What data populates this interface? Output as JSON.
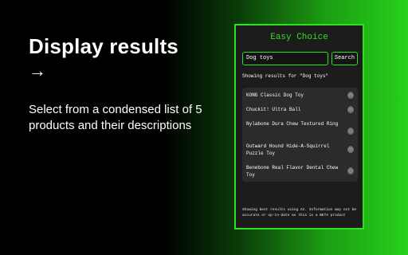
{
  "promo": {
    "title": "Display results",
    "arrow": "→",
    "description": "Select from a condensed list of 5 products and their descriptions"
  },
  "popup": {
    "app_title": "Easy Choice",
    "search_value": "Dog toys",
    "search_button": "Search",
    "results_heading": "Showing results for \"Dog toys\"",
    "results": [
      {
        "name": "KONG Classic Dog Toy",
        "info_icon": "ⓘ"
      },
      {
        "name": "Chuckit! Ultra Ball",
        "info_icon": "ⓘ"
      },
      {
        "name": "Nylabone Dura Chew Textured Ring",
        "info_icon": "ⓘ"
      },
      {
        "name": "Outward Hound Hide-A-Squirrel Puzzle Toy",
        "info_icon": "ⓘ"
      },
      {
        "name": "Benebone Real Flavor Dental Chew Toy",
        "info_icon": "ⓘ"
      }
    ],
    "disclaimer": "Showing best results using AI. Information may not be accurate or up-to-date as this is a BETA product"
  },
  "colors": {
    "accent": "#2ee01f",
    "popup_bg": "#1c1c1c",
    "list_bg": "#2b2b2b"
  }
}
